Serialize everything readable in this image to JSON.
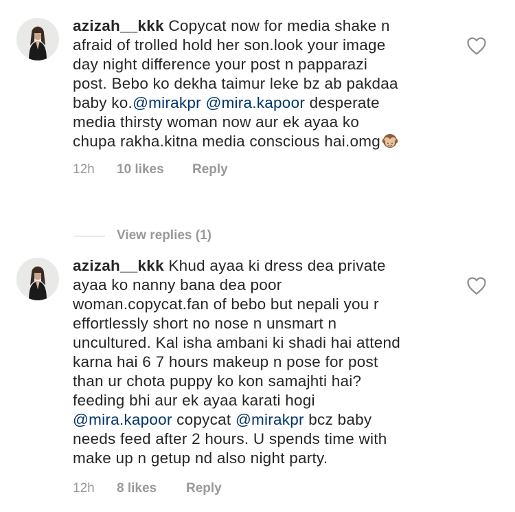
{
  "comments": [
    {
      "username": "azizah__kkk",
      "text_lines": [
        [
          {
            "t": "Copycat now for media shake n"
          }
        ],
        [
          {
            "t": "afraid of trolled hold her son.look your image"
          }
        ],
        [
          {
            "t": "day night difference your post n papparazi"
          }
        ],
        [
          {
            "t": "post. Bebo ko dekha taimur leke bz ab pakdaa"
          }
        ],
        [
          {
            "t": "baby ko."
          },
          {
            "t": "@mirakpr",
            "mention": true
          },
          {
            "t": " "
          },
          {
            "t": "@mira.kapoor",
            "mention": true
          },
          {
            "t": " desperate"
          }
        ],
        [
          {
            "t": "media thirsty woman now aur ek ayaa ko"
          }
        ],
        [
          {
            "t": "chupa rakha.kitna media conscious hai.omg"
          },
          {
            "emoji": "see-no-evil-monkey"
          }
        ]
      ],
      "time": "12h",
      "likes": "10 likes",
      "reply_label": "Reply"
    },
    {
      "username": "azizah__kkk",
      "text_lines": [
        [
          {
            "t": "Khud ayaa ki dress dea private"
          }
        ],
        [
          {
            "t": "ayaa ko nanny bana dea poor"
          }
        ],
        [
          {
            "t": "woman.copycat.fan of bebo but nepali you r"
          }
        ],
        [
          {
            "t": "effortlessly short no nose n unsmart n"
          }
        ],
        [
          {
            "t": "uncultured. Kal isha ambani ki shadi hai attend"
          }
        ],
        [
          {
            "t": "karna hai 6 7 hours makeup n pose for post"
          }
        ],
        [
          {
            "t": "than ur chota puppy ko kon samajhti hai?"
          }
        ],
        [
          {
            "t": "feeding bhi aur ek ayaa karati hogi"
          }
        ],
        [
          {
            "t": "@mira.kapoor",
            "mention": true
          },
          {
            "t": " copycat "
          },
          {
            "t": "@mirakpr",
            "mention": true
          },
          {
            "t": "  bcz baby"
          }
        ],
        [
          {
            "t": "needs feed after 2 hours. U spends time with"
          }
        ],
        [
          {
            "t": "make up n getup nd also night party."
          }
        ]
      ],
      "time": "12h",
      "likes": "8 likes",
      "reply_label": "Reply"
    }
  ],
  "view_replies": "View replies (1)",
  "icons": {
    "like": "heart-outline-icon",
    "emoji": "see-no-evil-monkey-emoji"
  },
  "colors": {
    "text": "#262626",
    "mention": "#003569",
    "meta": "#999999",
    "divider": "#c7c7c7",
    "background": "#ffffff"
  }
}
